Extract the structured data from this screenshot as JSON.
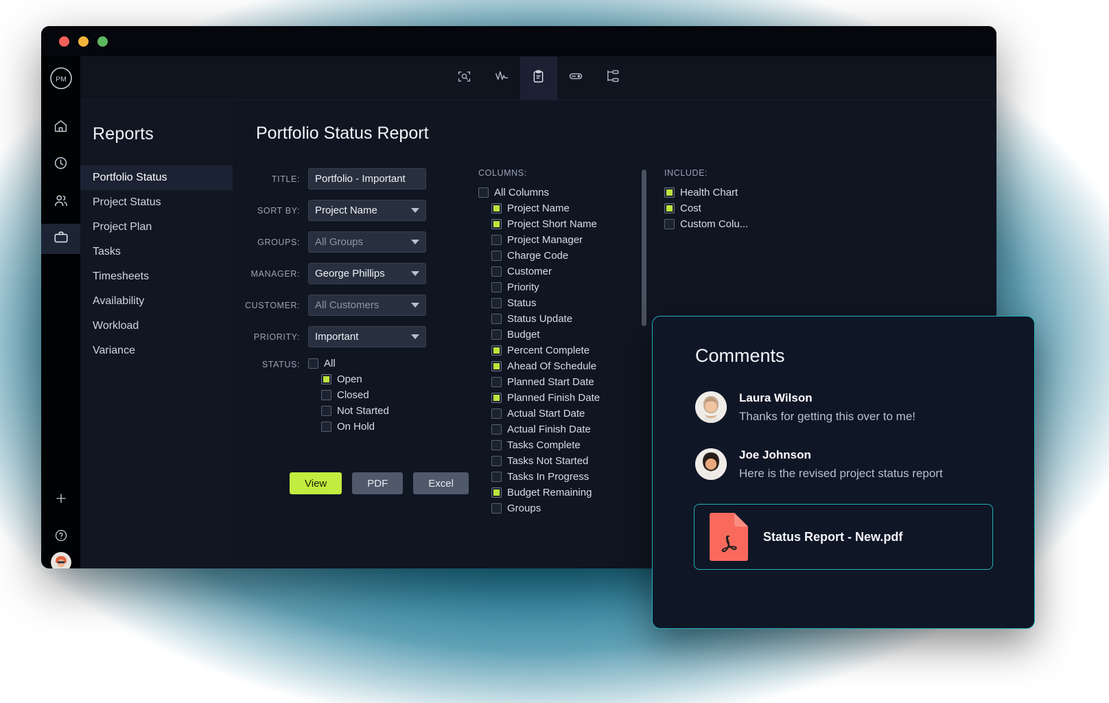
{
  "window": {
    "traffic_lights": [
      "close",
      "minimize",
      "maximize"
    ],
    "logo_text": "PM"
  },
  "toolbar": {
    "items": [
      {
        "name": "scan-search-icon",
        "label": "Scan",
        "active": false
      },
      {
        "name": "activity-chart-icon",
        "label": "Activity",
        "active": false
      },
      {
        "name": "clipboard-report-icon",
        "label": "Reports",
        "active": true
      },
      {
        "name": "toggle-switch-icon",
        "label": "Toggle",
        "active": false
      },
      {
        "name": "hierarchy-icon",
        "label": "Hierarchy",
        "active": false
      }
    ]
  },
  "rail": {
    "items": [
      {
        "name": "home-icon",
        "label": "Home",
        "active": false
      },
      {
        "name": "clock-icon",
        "label": "Time",
        "active": false
      },
      {
        "name": "people-icon",
        "label": "Team",
        "active": false
      },
      {
        "name": "briefcase-icon",
        "label": "Portfolio",
        "active": true
      }
    ],
    "bottom": [
      {
        "name": "plus-icon",
        "label": "Add"
      },
      {
        "name": "help-icon",
        "label": "Help"
      }
    ]
  },
  "reports": {
    "title": "Reports",
    "items": [
      {
        "label": "Portfolio Status",
        "active": true
      },
      {
        "label": "Project Status",
        "active": false
      },
      {
        "label": "Project Plan",
        "active": false
      },
      {
        "label": "Tasks",
        "active": false
      },
      {
        "label": "Timesheets",
        "active": false
      },
      {
        "label": "Availability",
        "active": false
      },
      {
        "label": "Workload",
        "active": false
      },
      {
        "label": "Variance",
        "active": false
      }
    ]
  },
  "main": {
    "page_title": "Portfolio Status Report",
    "fields": [
      {
        "label": "TITLE:",
        "value": "Portfolio - Important",
        "type": "text",
        "placeholder": false
      },
      {
        "label": "SORT BY:",
        "value": "Project Name",
        "type": "select",
        "placeholder": false
      },
      {
        "label": "GROUPS:",
        "value": "All Groups",
        "type": "select",
        "placeholder": true
      },
      {
        "label": "MANAGER:",
        "value": "George Phillips",
        "type": "select",
        "placeholder": false
      },
      {
        "label": "CUSTOMER:",
        "value": "All Customers",
        "type": "select",
        "placeholder": true
      },
      {
        "label": "PRIORITY:",
        "value": "Important",
        "type": "select",
        "placeholder": false
      }
    ],
    "status": {
      "label": "STATUS:",
      "options": [
        {
          "label": "All",
          "checked": false,
          "indent": false
        },
        {
          "label": "Open",
          "checked": true,
          "indent": true
        },
        {
          "label": "Closed",
          "checked": false,
          "indent": true
        },
        {
          "label": "Not Started",
          "checked": false,
          "indent": true
        },
        {
          "label": "On Hold",
          "checked": false,
          "indent": true
        }
      ]
    },
    "buttons": [
      {
        "label": "View",
        "style": "primary"
      },
      {
        "label": "PDF",
        "style": "secondary"
      },
      {
        "label": "Excel",
        "style": "secondary"
      }
    ],
    "columns": {
      "label": "COLUMNS:",
      "options": [
        {
          "label": "All Columns",
          "checked": false,
          "indent": false
        },
        {
          "label": "Project Name",
          "checked": true,
          "indent": true
        },
        {
          "label": "Project Short Name",
          "checked": true,
          "indent": true
        },
        {
          "label": "Project Manager",
          "checked": false,
          "indent": true
        },
        {
          "label": "Charge Code",
          "checked": false,
          "indent": true
        },
        {
          "label": "Customer",
          "checked": false,
          "indent": true
        },
        {
          "label": "Priority",
          "checked": false,
          "indent": true
        },
        {
          "label": "Status",
          "checked": false,
          "indent": true
        },
        {
          "label": "Status Update",
          "checked": false,
          "indent": true
        },
        {
          "label": "Budget",
          "checked": false,
          "indent": true
        },
        {
          "label": "Percent Complete",
          "checked": true,
          "indent": true
        },
        {
          "label": "Ahead Of Schedule",
          "checked": true,
          "indent": true
        },
        {
          "label": "Planned Start Date",
          "checked": false,
          "indent": true
        },
        {
          "label": "Planned Finish Date",
          "checked": true,
          "indent": true
        },
        {
          "label": "Actual Start Date",
          "checked": false,
          "indent": true
        },
        {
          "label": "Actual Finish Date",
          "checked": false,
          "indent": true
        },
        {
          "label": "Tasks Complete",
          "checked": false,
          "indent": true
        },
        {
          "label": "Tasks Not Started",
          "checked": false,
          "indent": true
        },
        {
          "label": "Tasks In Progress",
          "checked": false,
          "indent": true
        },
        {
          "label": "Budget Remaining",
          "checked": true,
          "indent": true
        },
        {
          "label": "Groups",
          "checked": false,
          "indent": true
        }
      ]
    },
    "include": {
      "label": "INCLUDE:",
      "options": [
        {
          "label": "Health Chart",
          "checked": true
        },
        {
          "label": "Cost",
          "checked": true
        },
        {
          "label": "Custom Colu...",
          "checked": false
        }
      ]
    }
  },
  "comments": {
    "title": "Comments",
    "items": [
      {
        "author": "Laura Wilson",
        "text": "Thanks for getting this over to me!"
      },
      {
        "author": "Joe Johnson",
        "text": "Here is the revised project status report"
      }
    ],
    "attachment": {
      "name": "Status Report - New.pdf",
      "icon": "pdf-file-icon"
    }
  },
  "colors": {
    "accent_lime": "#c2ec3f",
    "accent_teal": "#23b0b8",
    "panel_bg": "#101522",
    "window_bg": "#0a0e1a",
    "pdf_red": "#f96a5d"
  }
}
